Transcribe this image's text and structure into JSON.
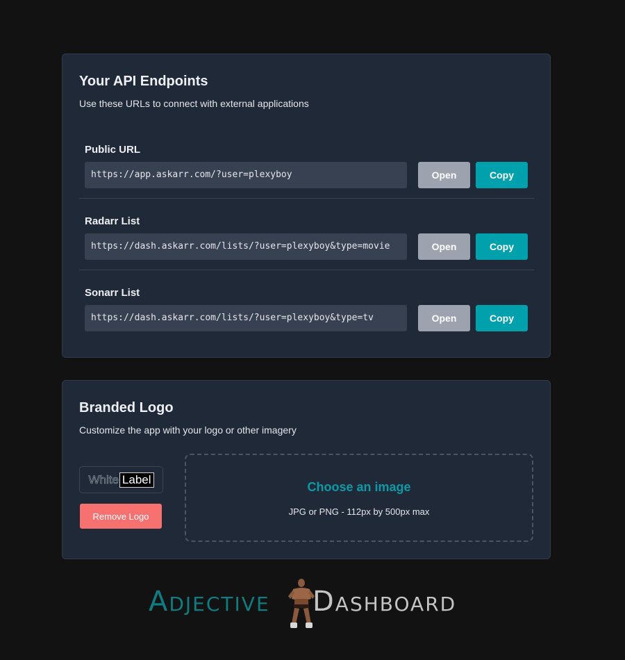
{
  "api_card": {
    "title": "Your API Endpoints",
    "subtitle": "Use these URLs to connect with external applications",
    "endpoints": [
      {
        "label": "Public URL",
        "url": "https://app.askarr.com/?user=plexyboy",
        "open_label": "Open",
        "copy_label": "Copy"
      },
      {
        "label": "Radarr List",
        "url": "https://dash.askarr.com/lists/?user=plexyboy&type=movie",
        "open_label": "Open",
        "copy_label": "Copy"
      },
      {
        "label": "Sonarr List",
        "url": "https://dash.askarr.com/lists/?user=plexyboy&type=tv",
        "open_label": "Open",
        "copy_label": "Copy"
      }
    ]
  },
  "logo_card": {
    "title": "Branded Logo",
    "subtitle": "Customize the app with your logo or other imagery",
    "preview_text_a": "White",
    "preview_text_b": "Label",
    "remove_label": "Remove Logo",
    "dropzone_title": "Choose an image",
    "dropzone_hint": "JPG or PNG - 112px by 500px max"
  },
  "brand": {
    "left_word": "Adjective",
    "right_word": "Dashboard",
    "mascot_icon": "wrestler-mascot-icon"
  },
  "colors": {
    "page_bg": "#121212",
    "card_bg": "#1f2937",
    "input_bg": "#374151",
    "open_btn": "#9ca3af",
    "copy_btn": "#00a0ac",
    "remove_btn": "#f87171",
    "accent_teal": "#0d9aa6",
    "brand_teal": "#0f7c82",
    "brand_grey": "#c4c4c4"
  }
}
